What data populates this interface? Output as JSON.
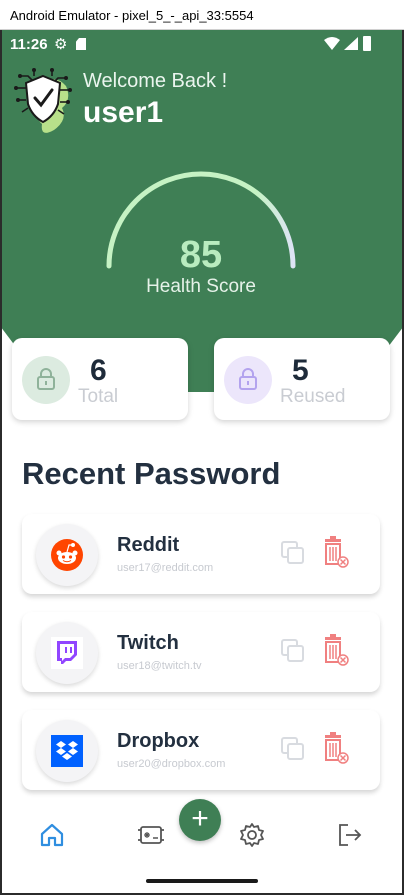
{
  "window": {
    "title": "Android Emulator - pixel_5_-_api_33:5554"
  },
  "status_bar": {
    "time": "11:26"
  },
  "header": {
    "welcome": "Welcome Back !",
    "username": "user1"
  },
  "health": {
    "score": "85",
    "label": "Health Score",
    "fraction": 0.85
  },
  "stats": [
    {
      "value": "6",
      "label": "Total"
    },
    {
      "value": "5",
      "label": "Reused"
    }
  ],
  "recent": {
    "title": "Recent Password",
    "items": [
      {
        "name": "Reddit",
        "email": "user17@reddit.com",
        "icon": "reddit-icon"
      },
      {
        "name": "Twitch",
        "email": "user18@twitch.tv",
        "icon": "twitch-icon"
      },
      {
        "name": "Dropbox",
        "email": "user20@dropbox.com",
        "icon": "dropbox-icon"
      }
    ]
  },
  "nav": {
    "fab_symbol": "+"
  },
  "colors": {
    "brand": "#3f7f55",
    "score": "#b9ecbf",
    "delete": "#f08080",
    "active_nav": "#2f8ee0"
  }
}
